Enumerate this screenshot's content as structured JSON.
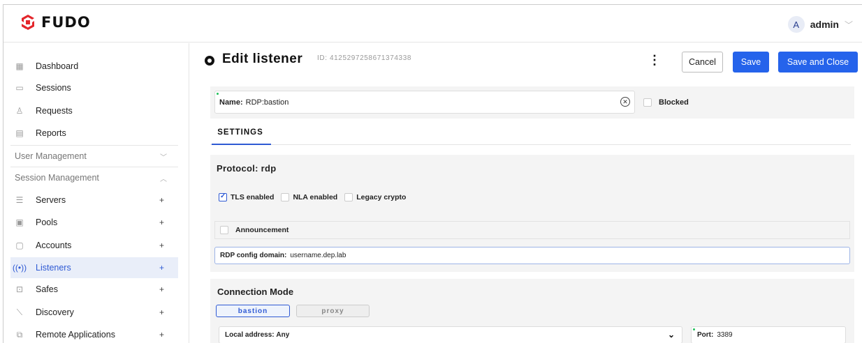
{
  "brand": {
    "name": "FUDO",
    "color": "#e3262b"
  },
  "user": {
    "initial": "A",
    "name": "admin"
  },
  "sidebar": {
    "items_top": [
      {
        "label": "Dashboard",
        "icon": "dashboard-icon"
      },
      {
        "label": "Sessions",
        "icon": "sessions-icon"
      },
      {
        "label": "Requests",
        "icon": "requests-icon"
      },
      {
        "label": "Reports",
        "icon": "reports-icon"
      }
    ],
    "groups": [
      {
        "label": "User Management",
        "expanded": false
      },
      {
        "label": "Session Management",
        "expanded": true
      }
    ],
    "items_session": [
      {
        "label": "Servers",
        "icon": "servers-icon"
      },
      {
        "label": "Pools",
        "icon": "pools-icon"
      },
      {
        "label": "Accounts",
        "icon": "accounts-icon"
      },
      {
        "label": "Listeners",
        "icon": "listeners-icon",
        "active": true
      },
      {
        "label": "Safes",
        "icon": "safes-icon"
      },
      {
        "label": "Discovery",
        "icon": "discovery-icon"
      },
      {
        "label": "Remote Applications",
        "icon": "remote-applications-icon"
      }
    ],
    "add_symbol": "+"
  },
  "header": {
    "title": "Edit listener",
    "id_text": "ID: 4125297258671374338",
    "more_symbol": "⋮",
    "cancel_label": "Cancel",
    "save_label": "Save",
    "save_close_label": "Save and Close",
    "accent_color": "#2563eb"
  },
  "name_field": {
    "label": "Name:",
    "value": "RDP:bastion"
  },
  "blocked": {
    "label": "Blocked",
    "checked": false
  },
  "tabs": [
    {
      "label": "SETTINGS",
      "active": true
    }
  ],
  "protocol": {
    "heading": "Protocol: rdp",
    "options": [
      {
        "label": "TLS enabled",
        "checked": true
      },
      {
        "label": "NLA enabled",
        "checked": false
      },
      {
        "label": "Legacy crypto",
        "checked": false
      }
    ],
    "announcement": {
      "label": "Announcement",
      "checked": false
    },
    "rdp_domain": {
      "label": "RDP config domain:",
      "value": "username.dep.lab"
    }
  },
  "connection_mode": {
    "heading": "Connection Mode",
    "modes": [
      {
        "label": "bastion",
        "selected": true
      },
      {
        "label": "proxy",
        "selected": false
      }
    ],
    "local_address": {
      "label": "Local address:",
      "value": "Any"
    },
    "port": {
      "label": "Port:",
      "value": "3389"
    }
  }
}
